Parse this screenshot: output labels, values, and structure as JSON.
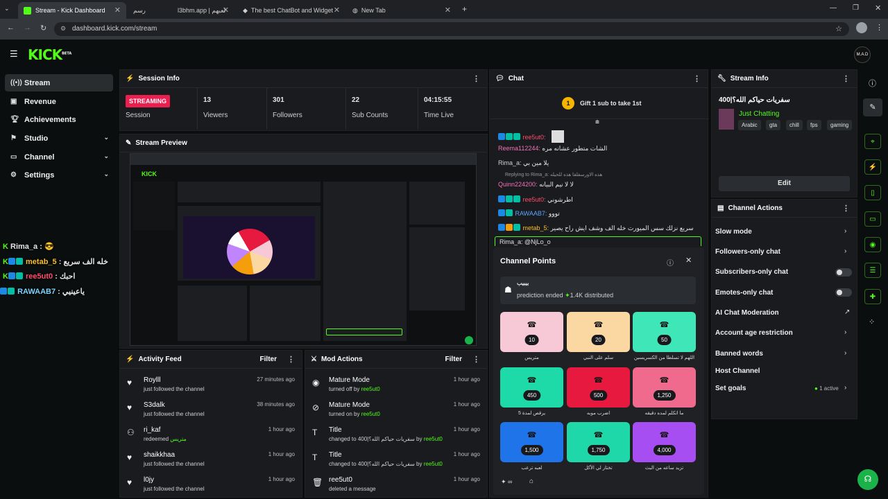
{
  "browser": {
    "tabs": [
      {
        "title": "Stream - Kick Dashboard"
      },
      {
        "title": "رسم"
      },
      {
        "title": "l3bhm.app | لعبهم"
      },
      {
        "title": "The best ChatBot and Widget"
      },
      {
        "title": "New Tab"
      }
    ],
    "url": "dashboard.kick.com/stream"
  },
  "app": {
    "logo": "KICK",
    "logo_sup": "BETA",
    "avatar": "M.A.D"
  },
  "sidebar": {
    "items": [
      {
        "label": "Stream"
      },
      {
        "label": "Revenue"
      },
      {
        "label": "Achievements"
      },
      {
        "label": "Studio"
      },
      {
        "label": "Channel"
      },
      {
        "label": "Settings"
      }
    ]
  },
  "overlay_chat": [
    {
      "user": "Rima_a",
      "msg": ": 😎"
    },
    {
      "user": "metab_5",
      "msg": "خله الف سريع"
    },
    {
      "user": "ree5ut0",
      "msg": ": احبك"
    },
    {
      "user": "RAWAAB7",
      "msg": ": ياعينيي"
    }
  ],
  "session": {
    "title": "Session Info",
    "status": "STREAMING",
    "status_label": "Session",
    "stats": [
      {
        "value": "13",
        "label": "Viewers"
      },
      {
        "value": "301",
        "label": "Followers"
      },
      {
        "value": "22",
        "label": "Sub Counts"
      },
      {
        "value": "04:15:55",
        "label": "Time Live"
      }
    ]
  },
  "preview": {
    "title": "Stream Preview"
  },
  "activity": {
    "title": "Activity Feed",
    "filter": "Filter",
    "items": [
      {
        "name": "Roylll",
        "desc": "just followed the channel",
        "time": "27 minutes ago"
      },
      {
        "name": "S3dalk",
        "desc": "just followed the channel",
        "time": "38 minutes ago"
      },
      {
        "name": "ri_kaf",
        "desc": "redeemed",
        "reward": "متريس",
        "time": "1 hour ago"
      },
      {
        "name": "shaikkhaa",
        "desc": "just followed the channel",
        "time": "1 hour ago"
      },
      {
        "name": "l0jy",
        "desc": "just followed the channel",
        "time": "1 hour ago"
      }
    ]
  },
  "mod": {
    "title": "Mod Actions",
    "filter": "Filter",
    "items": [
      {
        "name": "Mature Mode",
        "desc": "turned off by",
        "by": "ree5ut0",
        "time": "1 hour ago"
      },
      {
        "name": "Mature Mode",
        "desc": "turned on by",
        "by": "ree5ut0",
        "time": "1 hour ago"
      },
      {
        "name": "Title",
        "desc": "changed to 400|سفريات حياكم الله؟ by",
        "by": "ree5ut0",
        "time": "1 hour ago"
      },
      {
        "name": "Title",
        "desc": "changed to 400|سفريات حياكم الله؟ by",
        "by": "ree5ut0",
        "time": "1 hour ago"
      },
      {
        "name": "ree5ut0",
        "desc": "deleted a message",
        "by": "",
        "time": "1 hour ago"
      }
    ]
  },
  "chat": {
    "title": "Chat",
    "gift_count": "1",
    "gift_text": "Gift 1 sub to take 1st",
    "lines": [
      {
        "user": "ree5ut0:",
        "msg": ""
      },
      {
        "user": "Reema112244:",
        "msg": "الشات متطور عشانه مره"
      },
      {
        "user": "Rima_a:",
        "msg": "يلا مين بي"
      },
      {
        "user": "Replying to Rima_a:",
        "msg": "هذه الاورسفلفا هذه للحيله"
      },
      {
        "user": "Quinn224200:",
        "msg": "لا لا نيم البيانه"
      },
      {
        "user": "ree5ut0:",
        "msg": "اطرشوني"
      },
      {
        "user": "RAWAAB7:",
        "msg": "تووو"
      },
      {
        "user": "metab_5:",
        "msg": "سريع نزلك سس الميورت خله الف وشف ايش راح يصير"
      }
    ],
    "input_value": "Rima_a: @NjLo_o"
  },
  "channel_points": {
    "title": "Channel Points",
    "prediction_user": "بيبيب",
    "prediction_text": "prediction ended",
    "prediction_amount": "1.4K distributed",
    "rewards": [
      {
        "cost": "10",
        "label": "متريس",
        "color": "#f7c9d6"
      },
      {
        "cost": "20",
        "label": "سلم على النبي",
        "color": "#fbd7a1"
      },
      {
        "cost": "50",
        "label": "اللهم لا تسلطا من الكسريسين",
        "color": "#3ee6b8"
      },
      {
        "cost": "450",
        "label": "يرقص لمدة 5",
        "color": "#1ed9a8"
      },
      {
        "cost": "500",
        "label": "اضرب موبه",
        "color": "#e8193f"
      },
      {
        "cost": "1,250",
        "label": "ما اتكلم لمده دقيقه",
        "color": "#ef6a8d"
      },
      {
        "cost": "1,500",
        "label": "لعبه ترعب",
        "color": "#1e74e8"
      },
      {
        "cost": "1,750",
        "label": "تختار لي الأكل",
        "color": "#1fd8a9"
      },
      {
        "cost": "4,000",
        "label": "تزيد ساعه من البث",
        "color": "#a64ef2"
      }
    ],
    "balance": "∞"
  },
  "stream_info": {
    "title": "Stream Info",
    "stream_title": "400|سفريات حياكم الله؟",
    "category": "Just Chatting",
    "tags": [
      "Arabic",
      "gta",
      "chill",
      "fps",
      "gaming"
    ],
    "edit": "Edit"
  },
  "channel_actions": {
    "title": "Channel Actions",
    "items": [
      {
        "label": "Slow mode"
      },
      {
        "label": "Followers-only chat"
      },
      {
        "label": "Subscribers-only chat"
      },
      {
        "label": "Emotes-only chat"
      },
      {
        "label": "AI Chat Moderation"
      },
      {
        "label": "Account age restriction"
      },
      {
        "label": "Banned words"
      },
      {
        "label": "Host Channel"
      },
      {
        "label": "Set goals"
      }
    ],
    "goals_status": "1 active"
  },
  "colors": {
    "accent": "#53fc18",
    "live": "#e91f4f",
    "panel": "#191b1f"
  }
}
